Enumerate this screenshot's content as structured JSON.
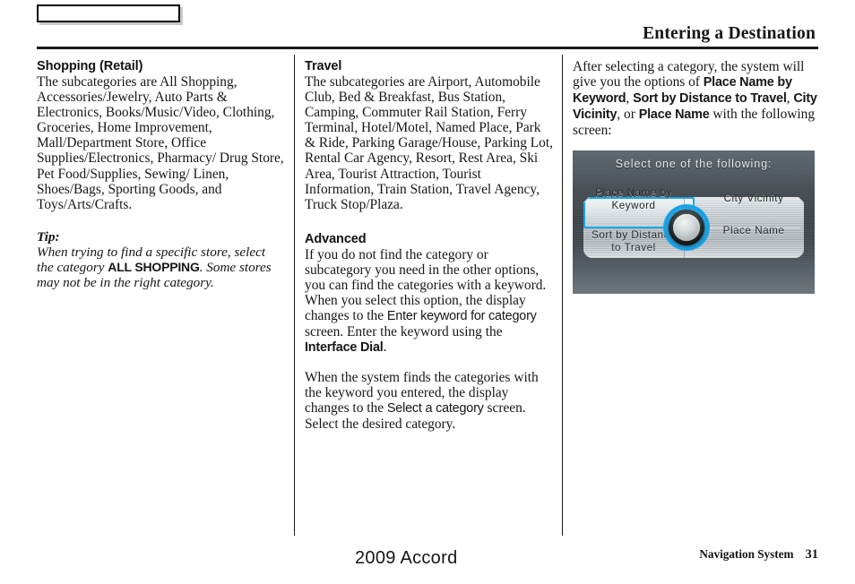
{
  "header": {
    "title": "Entering a Destination",
    "tab_box_label": ""
  },
  "columns": {
    "col1": {
      "section_title": "Shopping (Retail)",
      "body": "The subcategories are All Shopping, Accessories/Jewelry, Auto Parts & Electronics, Books/Music/Video, Clothing, Groceries, Home Improvement, Mall/Department Store, Office Supplies/Electronics, Pharmacy/ Drug Store, Pet Food/Supplies, Sewing/ Linen, Shoes/Bags, Sporting Goods, and Toys/Arts/Crafts.",
      "tip_label": "Tip:",
      "tip_part1": "When trying to find a specific store, select the category ",
      "tip_emphasis": "ALL SHOPPING",
      "tip_part2": ". Some stores may not be in the right category."
    },
    "col2": {
      "section_title": "Travel",
      "body": "The subcategories are Airport, Automobile Club, Bed & Breakfast, Bus Station, Camping, Commuter Rail Station, Ferry Terminal, Hotel/Motel, Named Place, Park & Ride, Parking Garage/House, Parking Lot, Rental Car Agency, Resort, Rest Area, Ski Area, Tourist Attraction, Tourist Information, Train Station, Travel Agency, Truck Stop/Plaza.",
      "advanced_title": "Advanced",
      "advanced_part1": "If you do not find the category or subcategory you need in the other options, you can find the categories with a keyword. When you select this option, the display changes to the ",
      "advanced_screen1": "Enter keyword for category",
      "advanced_part2": " screen. Enter the keyword using the ",
      "advanced_dial": "Interface Dial",
      "advanced_part3": ".",
      "advanced2_part1": "When the system finds the categories with the keyword you entered, the display changes to the ",
      "advanced2_screen": "Select a category",
      "advanced2_part2": " screen. Select the desired category."
    },
    "col3": {
      "intro_part1": "After selecting a category, the system will give you the options of ",
      "option1": "Place Name by Keyword",
      "sep1": ", ",
      "option2": "Sort by Distance to Travel",
      "sep2": ", ",
      "option3": "City Vicinity",
      "sep3": ", or ",
      "option4": "Place Name",
      "intro_part2": " with the following screen:"
    }
  },
  "nav_screen": {
    "title": "Select one of the following:",
    "option_top_left": "Place Name by\nKeyword",
    "option_bottom_left": "Sort by Distance\nto Travel",
    "option_top_right": "City Vicinity",
    "option_bottom_right": "Place Name",
    "highlight_color": "#18a7e8",
    "dial_name": "interface-dial"
  },
  "footer": {
    "model": "2009  Accord",
    "manual": "Navigation System",
    "page": "31"
  }
}
